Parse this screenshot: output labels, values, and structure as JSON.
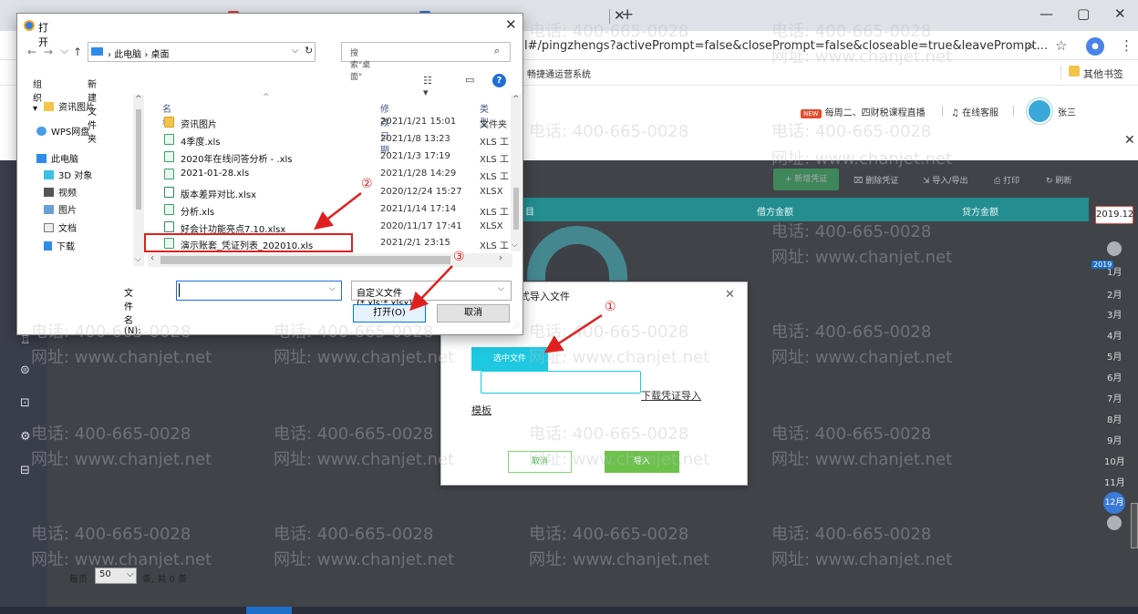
{
  "browser": {
    "tabs": [
      {
        "label": "400-665-0028"
      },
      {
        "label": ""
      },
      {
        "label": ""
      },
      {
        "label": ""
      }
    ],
    "url": "l#/pingzhengs?activePrompt=false&closePrompt=false&closeable=true&leavePrompt...",
    "bookmark": "畅捷通运营系统",
    "other_bookmarks": "其他书签",
    "win_min": "—",
    "win_max": "▢",
    "win_close": "✕"
  },
  "header": {
    "live_badge": "NEW",
    "live_text": "每周二、四财税课程直播",
    "service": "在线客服",
    "username": "张三"
  },
  "toolbar": {
    "new_voucher": "+ 新增凭证",
    "delete_voucher": "删除凭证",
    "import_export": "导入/导出",
    "print": "打印",
    "refresh": "刷新"
  },
  "table": {
    "col_summary": "目",
    "col_debit": "借方金额",
    "col_credit": "贷方金额"
  },
  "pager": {
    "per_page_label": "每页",
    "per_page_value": "50",
    "count_text": "条, 共 0 条"
  },
  "months": {
    "year_chip": "2019.12",
    "year_badge": "2019",
    "items": [
      "1月",
      "2月",
      "3月",
      "4月",
      "5月",
      "6月",
      "7月",
      "8月",
      "9月",
      "10月",
      "11月"
    ],
    "current": "12月"
  },
  "import_dialog": {
    "title": "式导入文件",
    "select_file": "选中文件",
    "download_link": "下载凭证导入",
    "template_link": "模板",
    "cancel": "取消",
    "import": "导入"
  },
  "file_dialog": {
    "title": "打开",
    "breadcrumb": [
      "此电脑",
      "桌面"
    ],
    "search_placeholder": "搜索\"桌面\"",
    "organize": "组织 ▾",
    "new_folder": "新建文件夹",
    "nav_items": [
      "资讯图片",
      "WPS网盘",
      "此电脑",
      "3D 对象",
      "视频",
      "图片",
      "文档",
      "下载"
    ],
    "columns": {
      "name": "名称",
      "date": "修改日期",
      "type": "类型"
    },
    "files": [
      {
        "name": "资讯图片",
        "date": "2021/1/21 15:01",
        "type": "文件夹",
        "kind": "folder"
      },
      {
        "name": "4季度.xls",
        "date": "2021/1/8 13:23",
        "type": "XLS 工",
        "kind": "xls"
      },
      {
        "name": "2020年在线问答分析 - .xls",
        "date": "2021/1/3 17:19",
        "type": "XLS 工",
        "kind": "xls"
      },
      {
        "name": "2021-01-28.xls",
        "date": "2021/1/28 14:29",
        "type": "XLS 工",
        "kind": "xls"
      },
      {
        "name": "版本差异对比.xlsx",
        "date": "2020/12/24 15:27",
        "type": "XLSX",
        "kind": "xlsx"
      },
      {
        "name": "分析.xls",
        "date": "2021/1/14 17:14",
        "type": "XLS 工",
        "kind": "xls"
      },
      {
        "name": "好会计功能亮点7.10.xlsx",
        "date": "2020/11/17 17:41",
        "type": "XLSX",
        "kind": "xlsx"
      },
      {
        "name": "演示账套_凭证列表_202010.xls",
        "date": "2021/2/1 23:15",
        "type": "XLS 工",
        "kind": "xls"
      }
    ],
    "filename_label": "文件名(N):",
    "filetype": "自定义文件 (*.xls;*.xlsx)",
    "open": "打开(O)",
    "cancel": "取消"
  },
  "annotations": {
    "step1": "①",
    "step2": "②",
    "step3": "③",
    "color": "#e02020"
  },
  "watermark": {
    "phone": "电话: 400-665-0028",
    "site": "网址: www.chanjet.net"
  }
}
